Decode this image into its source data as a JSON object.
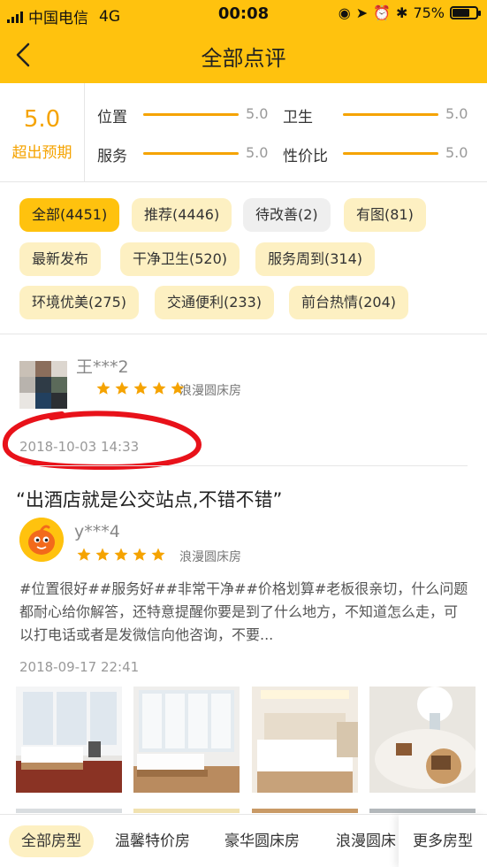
{
  "status_bar": {
    "carrier": "中国电信",
    "network": "4G",
    "time": "00:08",
    "battery": "75%",
    "battery_level": 0.75
  },
  "nav": {
    "title": "全部点评"
  },
  "rating": {
    "score": "5.0",
    "label": "超出预期",
    "metrics": [
      {
        "name": "位置",
        "value": "5.0",
        "fill": 1.0
      },
      {
        "name": "卫生",
        "value": "5.0",
        "fill": 1.0
      },
      {
        "name": "服务",
        "value": "5.0",
        "fill": 1.0
      },
      {
        "name": "性价比",
        "value": "5.0",
        "fill": 1.0
      }
    ]
  },
  "tags": [
    "全部(4451)",
    "推荐(4446)",
    "待改善(2)",
    "有图(81)",
    "最新发布",
    "干净卫生(520)",
    "服务周到(314)",
    "环境优美(275)",
    "交通便利(233)",
    "前台热情(204)"
  ],
  "reviews": [
    {
      "username": "王***2",
      "room": "浪漫圆床房",
      "date": "2018-10-03 14:33",
      "stars": 5
    },
    {
      "headline": "“出酒店就是公交站点,不错不错”",
      "username": "y***4",
      "room": "浪漫圆床房",
      "text": "#位置很好##服务好##非常干净##价格划算#老板很亲切，什么问题都耐心给你解答，还特意提醒你要是到了什么地方，不知道怎么走，可以打电话或者是发微信向他咨询，不要...",
      "date": "2018-09-17 22:41",
      "stars": 5
    }
  ],
  "room_tabs": {
    "items": [
      "全部房型",
      "温馨特价房",
      "豪华圆床房",
      "浪漫圆床"
    ],
    "more": "更多房型"
  },
  "colors": {
    "brand": "#ffc20e",
    "accent": "#f5a300",
    "tag_bg": "#fdf0c2",
    "annotation": "#e8121a"
  },
  "icons": [
    "back-arrow-icon",
    "signal-icon",
    "battery-icon",
    "star-icon"
  ]
}
